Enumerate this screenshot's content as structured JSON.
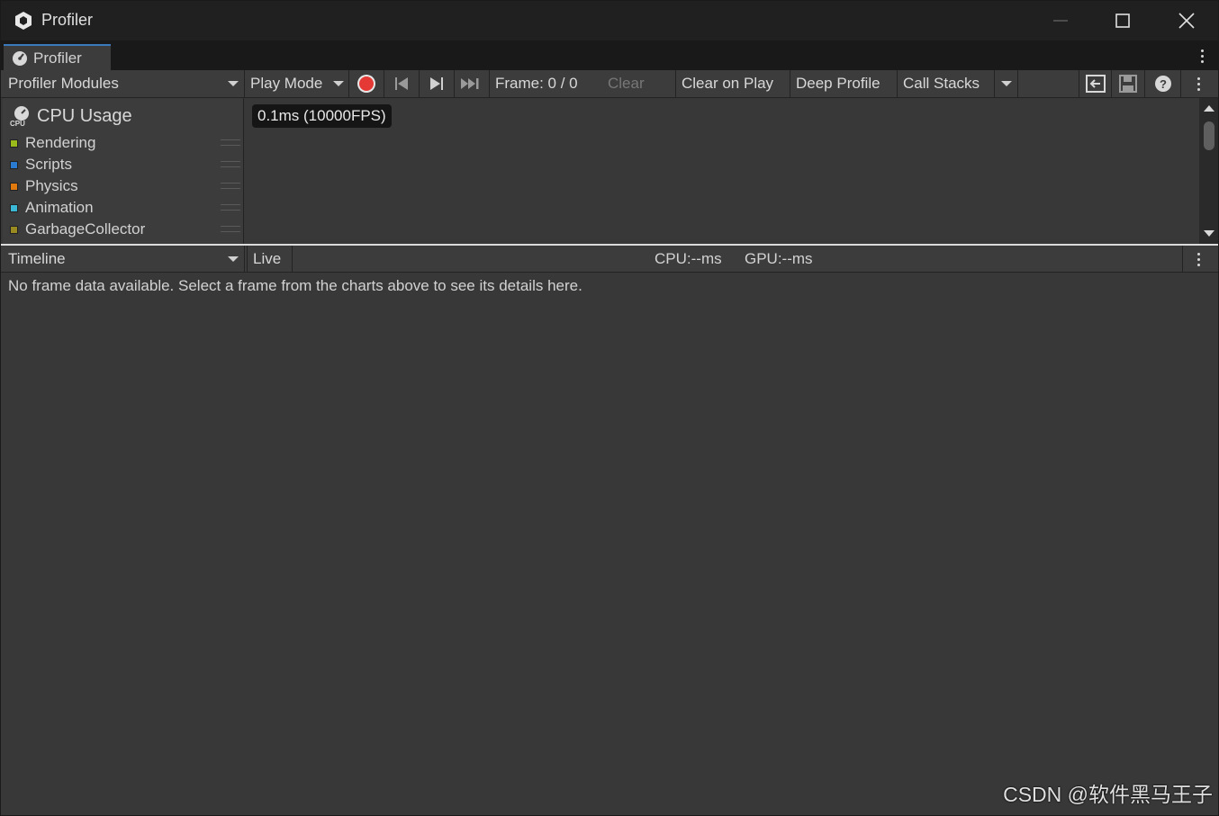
{
  "window": {
    "title": "Profiler",
    "tab_label": "Profiler"
  },
  "toolbar": {
    "modules_dropdown": "Profiler Modules",
    "target_dropdown": "Play Mode",
    "frame_label": "Frame: 0 / 0",
    "clear_label": "Clear",
    "clear_on_play_label": "Clear on Play",
    "deep_profile_label": "Deep Profile",
    "call_stacks_label": "Call Stacks"
  },
  "module": {
    "title": "CPU Usage",
    "icon_text": "CPU",
    "legend": [
      {
        "label": "Rendering",
        "color": "#9bbb1c"
      },
      {
        "label": "Scripts",
        "color": "#2a7bd2"
      },
      {
        "label": "Physics",
        "color": "#e07a0f"
      },
      {
        "label": "Animation",
        "color": "#3bb8d6"
      },
      {
        "label": "GarbageCollector",
        "color": "#9a8a22"
      }
    ]
  },
  "chart": {
    "fps_label": "0.1ms (10000FPS)"
  },
  "details": {
    "view_dropdown": "Timeline",
    "live_label": "Live",
    "cpu_label": "CPU:--ms",
    "gpu_label": "GPU:--ms",
    "empty_message": "No frame data available. Select a frame from the charts above to see its details here."
  },
  "watermark": "CSDN @软件黑马王子",
  "colors": {
    "record_button": "#e53935",
    "tab_accent": "#3a79bb"
  }
}
